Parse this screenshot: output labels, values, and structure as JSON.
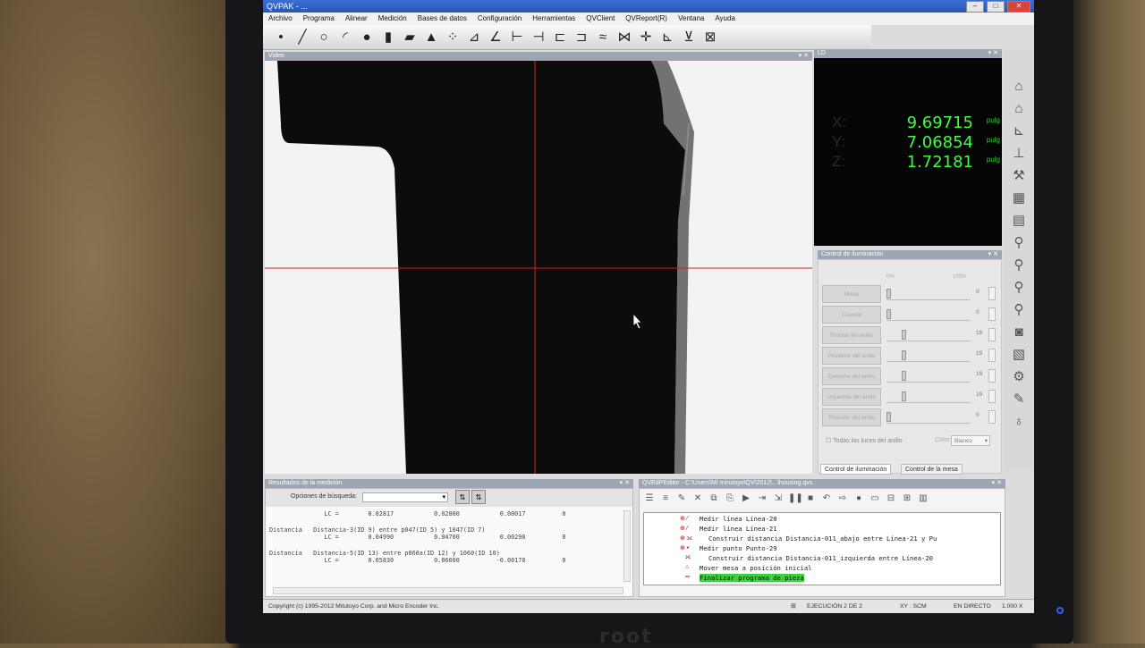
{
  "window": {
    "title": "QVPAK - ..."
  },
  "menu": [
    "Archivo",
    "Programa",
    "Alinear",
    "Medición",
    "Bases de datos",
    "Configuración",
    "Herramientas",
    "QVClient",
    "QVReport(R)",
    "Ventana",
    "Ayuda"
  ],
  "toolbar_icons": [
    "point-tool-icon",
    "line-tool-icon",
    "circle-tool-icon",
    "arc-tool-icon",
    "sphere-tool-icon",
    "cylinder-tool-icon",
    "plane-tool-icon",
    "cone-tool-icon",
    "pattern-tool-icon",
    "distance-tool-icon",
    "angle-tool-icon",
    "intersection-tool-icon",
    "midpoint-tool-icon",
    "projection-tool-icon",
    "offset-tool-icon",
    "align-tool-icon",
    "bisect-tool-icon",
    "crosshair-tool-icon",
    "datum-tool-icon",
    "tolerance-tool-icon",
    "report-tool-icon"
  ],
  "panels": {
    "video_title": "Video",
    "dro_title": "LD",
    "illum_title": "Control de iluminación",
    "results_title": "Resultados de la medición",
    "program_title": "QVEdPEditor - C:\\Users\\MI mirutoyo\\QV\\2012\\...\\housing.qvs"
  },
  "dro": {
    "x_label": "X:",
    "y_label": "Y:",
    "z_label": "Z:",
    "x_value": "9.69715",
    "y_value": "7.06854",
    "z_value": "1.72181",
    "unit": "pulg"
  },
  "illumination": {
    "scale_min": "0%",
    "scale_max": "100%",
    "rows": [
      {
        "label": "Mesa",
        "value": "0",
        "level": 0.0
      },
      {
        "label": "Coaxial",
        "value": "0",
        "level": 0.0
      },
      {
        "label": "Frontal del anillo",
        "value": "19",
        "level": 0.19
      },
      {
        "label": "Posterior del anillo",
        "value": "19",
        "level": 0.19
      },
      {
        "label": "Derecha del anillo",
        "value": "19",
        "level": 0.19
      },
      {
        "label": "Izquierda del anillo",
        "value": "19",
        "level": 0.19
      },
      {
        "label": "Posición del anillo",
        "value": "0",
        "level": 0.0
      }
    ],
    "all_lights_label": "Todas las luces del anillo",
    "color_label": "Color:",
    "color_value": "Blanco",
    "tab_illum": "Control de iluminación",
    "tab_table": "Control de la mesa"
  },
  "results": {
    "search_label": "Opciones de búsqueda:",
    "lines": [
      "               LC =        0.02817           0.02800           0.00017          0",
      "Distancia   Distancia-3(ID 9) entre p047(ID 5) y 1047(ID 7)",
      "               LC =        0.04990           0.04700           0.00290          0",
      "Distancia   Distancia-5(ID 13) entre p060a(ID 12) y 1060(ID 10)",
      "               LC =        0.05830           0.06000          -0.00170          0"
    ]
  },
  "program": {
    "lines": [
      {
        "icon": "line-icon",
        "text": "Medir línea Línea-20",
        "hl": false
      },
      {
        "icon": "line-icon",
        "text": "Medir línea Línea-21",
        "hl": false
      },
      {
        "icon": "distance-icon",
        "text": "Construir distancia Distancia-011_abajo entre Línea-21 y Pu",
        "hl": false
      },
      {
        "icon": "point-icon",
        "text": "Medir punto Punto-29",
        "hl": false
      },
      {
        "icon": "distance-icon",
        "text": "Construir distancia Distancia-011_izquierda entre Línea-20",
        "hl": false
      },
      {
        "icon": "home-icon",
        "text": "Mover mesa a posición inicial",
        "hl": false
      },
      {
        "icon": "end-icon",
        "text": "Finalizar programa de pieza",
        "hl": true
      }
    ]
  },
  "status": {
    "copyright": "Copyright (c) 1995-2012 Mitutoyo Corp. and Micro Encoder Inc.",
    "execution": "EJECUCIÓN 2 DE 2",
    "coords": "XY : SCM",
    "mode": "EN DIRECTO",
    "zoom": "1.000 X"
  },
  "brand": "root"
}
